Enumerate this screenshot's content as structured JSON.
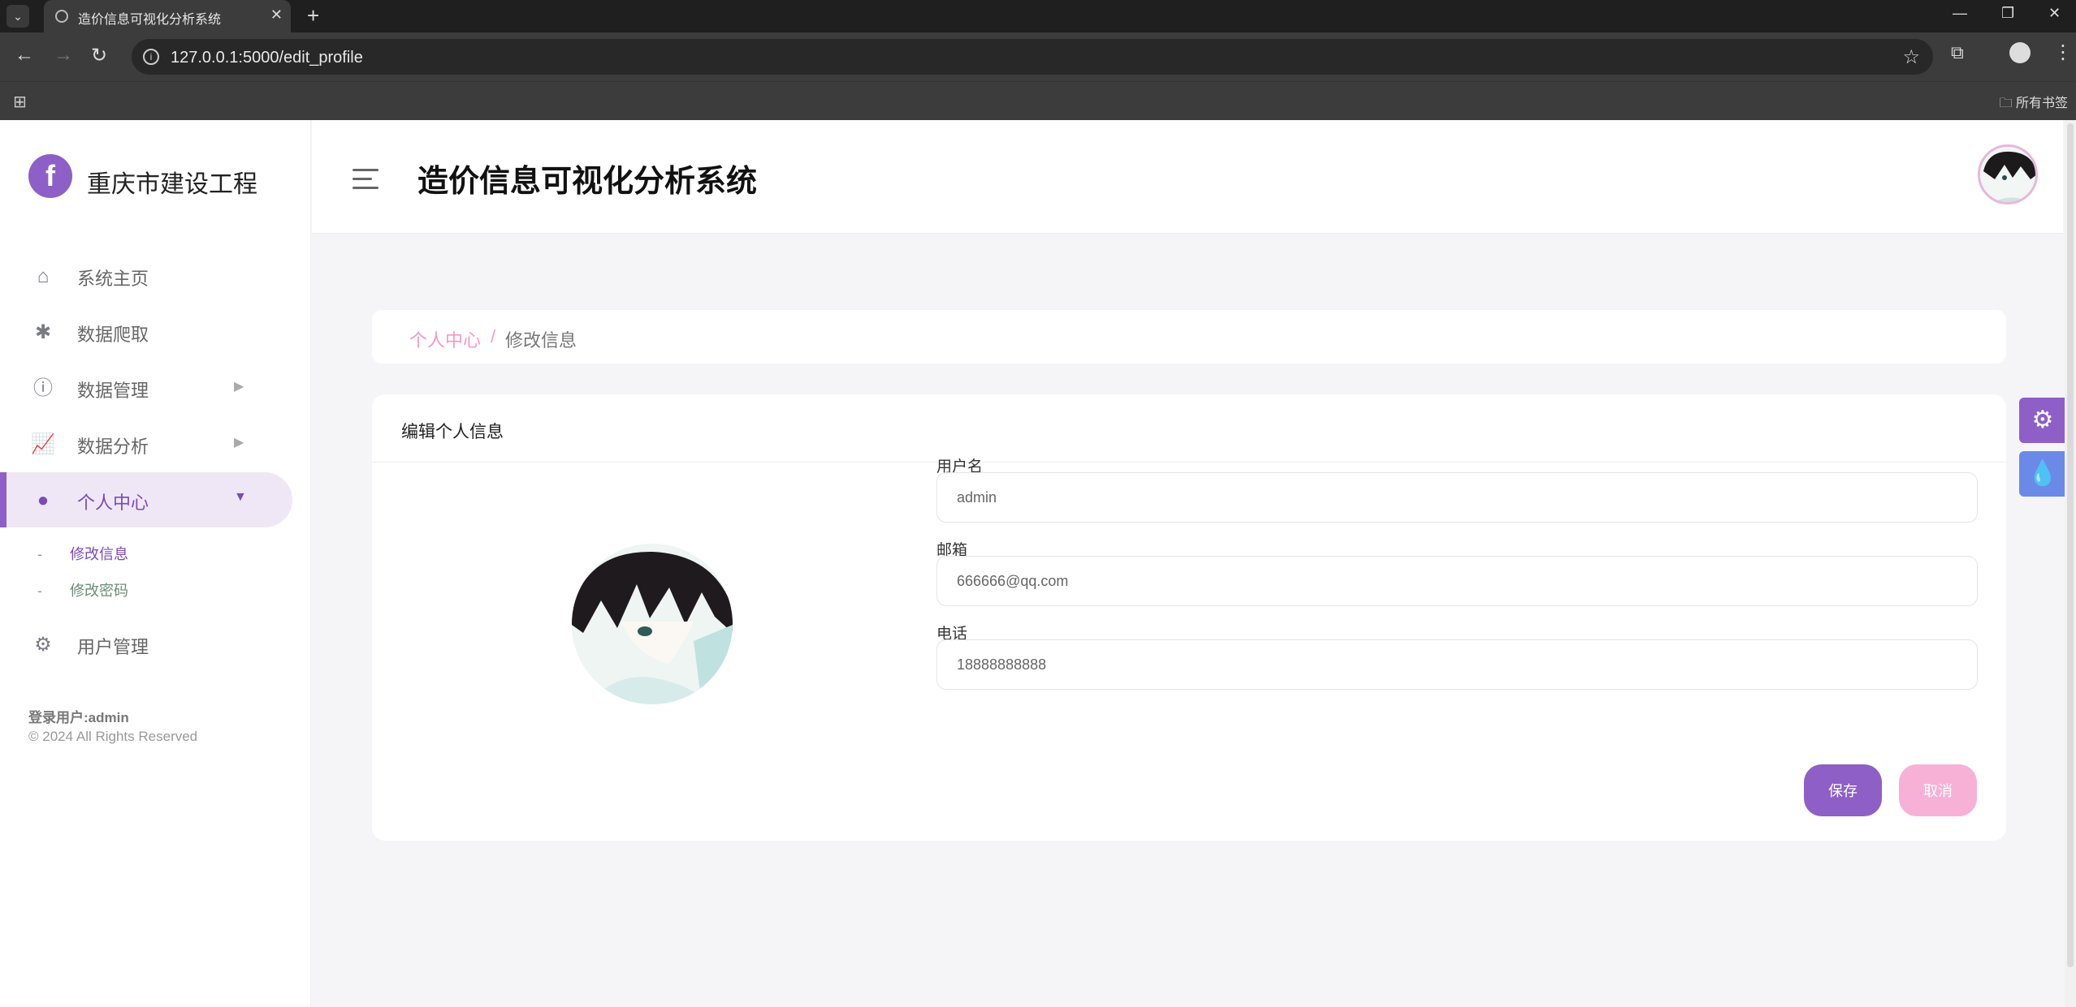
{
  "browser": {
    "tab_title": "造价信息可视化分析系统",
    "url": "127.0.0.1:5000/edit_profile",
    "bookmarks_label": "所有书签"
  },
  "sidebar": {
    "brand": "重庆市建设工程",
    "items": [
      {
        "label": "系统主页",
        "icon": "home-icon"
      },
      {
        "label": "数据爬取",
        "icon": "spider-icon"
      },
      {
        "label": "数据管理",
        "icon": "info-icon"
      },
      {
        "label": "数据分析",
        "icon": "chart-icon"
      },
      {
        "label": "个人中心",
        "icon": "user-icon"
      },
      {
        "label": "用户管理",
        "icon": "user-gear-icon"
      }
    ],
    "sub_items": [
      {
        "label": "修改信息"
      },
      {
        "label": "修改密码"
      }
    ],
    "footer_user": "登录用户:admin",
    "footer_copy": "© 2024 All Rights Reserved"
  },
  "header": {
    "title": "造价信息可视化分析系统"
  },
  "breadcrumb": {
    "parent": "个人中心",
    "separator": "/",
    "current": "修改信息"
  },
  "form": {
    "title": "编辑个人信息",
    "username_label": "用户名",
    "username_value": "admin",
    "email_label": "邮箱",
    "email_value": "666666@qq.com",
    "phone_label": "电话",
    "phone_value": "18888888888",
    "save_label": "保存",
    "cancel_label": "取消"
  },
  "colors": {
    "accent": "#8e5fc7",
    "pink": "#f7b1d7",
    "blue": "#6b8ae8"
  }
}
